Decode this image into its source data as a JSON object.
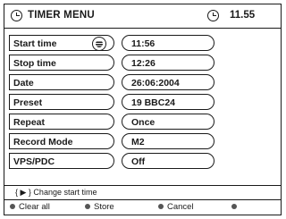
{
  "header": {
    "title": "TIMER MENU",
    "time": "11.55",
    "left_icon": "clock-icon",
    "right_icon": "clock-icon"
  },
  "rows": [
    {
      "label": "Start time",
      "value": "11:56",
      "selected": true,
      "icon": "record-icon"
    },
    {
      "label": "Stop time",
      "value": "12:26"
    },
    {
      "label": "Date",
      "value": "26:06:2004"
    },
    {
      "label": "Preset",
      "value": "19 BBC24"
    },
    {
      "label": "Repeat",
      "value": "Once"
    },
    {
      "label": "Record Mode",
      "value": "M2"
    },
    {
      "label": "VPS/PDC",
      "value": "Off"
    }
  ],
  "hint": "{ ▶ }  Change start time",
  "footer": {
    "clear_all": "Clear all",
    "store": "Store",
    "cancel": "Cancel",
    "empty": ""
  },
  "colors": {
    "foreground": "#1a1a1a",
    "background": "#ffffff",
    "dot": "#555555"
  }
}
